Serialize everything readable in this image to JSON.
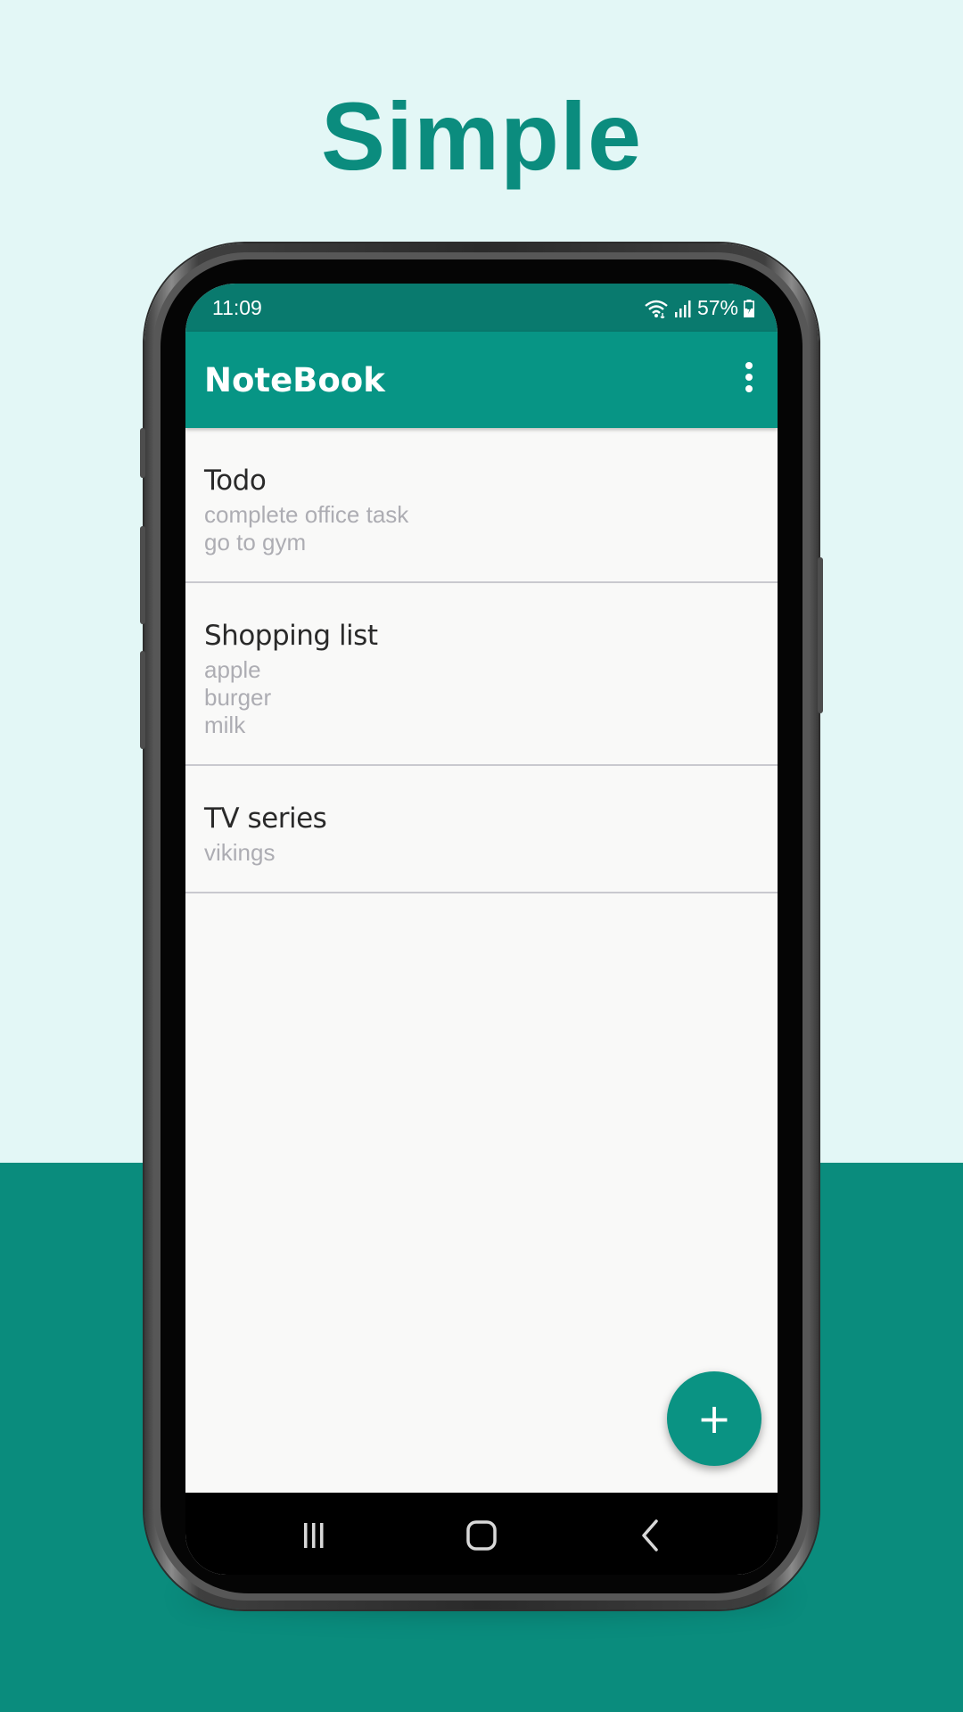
{
  "promo": {
    "headline": "Simple"
  },
  "status_bar": {
    "time": "11:09",
    "battery": "57%",
    "icons": [
      "wifi-icon",
      "signal-icon",
      "battery-charging-icon"
    ]
  },
  "app_bar": {
    "title": "NoteBook",
    "menu_icon": "more-vert-icon"
  },
  "notes": [
    {
      "title": "Todo",
      "lines": [
        "complete office task",
        "go to gym"
      ]
    },
    {
      "title": "Shopping list",
      "lines": [
        "apple",
        "burger",
        "milk"
      ]
    },
    {
      "title": "TV series",
      "lines": [
        "vikings"
      ]
    }
  ],
  "fab": {
    "label": "+",
    "icon": "add-icon"
  },
  "nav_bar": {
    "icons": [
      "recent-apps-icon",
      "home-icon",
      "back-icon"
    ]
  },
  "colors": {
    "accent": "#079585",
    "status_bar": "#097a6e",
    "background_light": "#e3f7f6",
    "background_dark": "#0a8c7d",
    "headline": "#0b8c7e"
  }
}
